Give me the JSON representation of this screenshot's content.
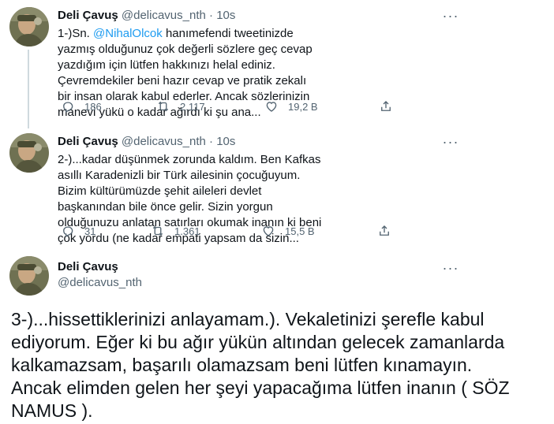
{
  "tweets": [
    {
      "name": "Deli Çavuş",
      "handle": "@delicavus_nth",
      "dot": "·",
      "time": "10s",
      "text_prefix": "1-)Sn. ",
      "mention": "@NihalOlcok",
      "text_suffix": " hanımefendi tweetinizde yazmış olduğunuz çok değerli sözlere geç cevap yazdığım için lütfen hakkınızı helal ediniz. Çevremdekiler beni hazır cevap ve pratik zekalı bir insan olarak kabul ederler. Ancak sözlerinizin manevi yükü o kadar ağırdı ki şu ana...",
      "replies": "186",
      "retweets": "2.117",
      "likes": "19,2 B"
    },
    {
      "name": "Deli Çavuş",
      "handle": "@delicavus_nth",
      "dot": "·",
      "time": "10s",
      "text": "2-)...kadar düşünmek zorunda kaldım. Ben Kafkas asıllı Karadenizli bir Türk ailesinin çocuğuyum. Bizim kültürümüzde şehit aileleri devlet başkanından bile önce gelir. Sizin yorgun olduğunuzu anlatan satırları okumak inanın ki beni çok yordu (ne kadar empati yapsam da sizin...",
      "replies": "31",
      "retweets": "1.361",
      "likes": "15,5 B"
    }
  ],
  "main_tweet": {
    "name": "Deli Çavuş",
    "handle": "@delicavus_nth",
    "text": "3-)...hissettiklerinizi anlayamam.).  Vekaletinizi şerefle kabul ediyorum. Eğer ki bu ağır yükün altından gelecek zamanlarda kalkamazsam, başarılı olamazsam beni lütfen kınamayın. Ancak elimden gelen her şeyi yapacağıma lütfen inanın ( SÖZ NAMUS )."
  },
  "more_label": "···",
  "icons": {
    "reply": "reply-icon",
    "retweet": "retweet-icon",
    "like": "heart-icon",
    "share": "share-icon",
    "more": "more-icon",
    "avatar": "avatar"
  },
  "colors": {
    "text": "#0f1419",
    "secondary": "#536471",
    "mention": "#1d9bf0",
    "thread_line": "#cfd9de"
  }
}
